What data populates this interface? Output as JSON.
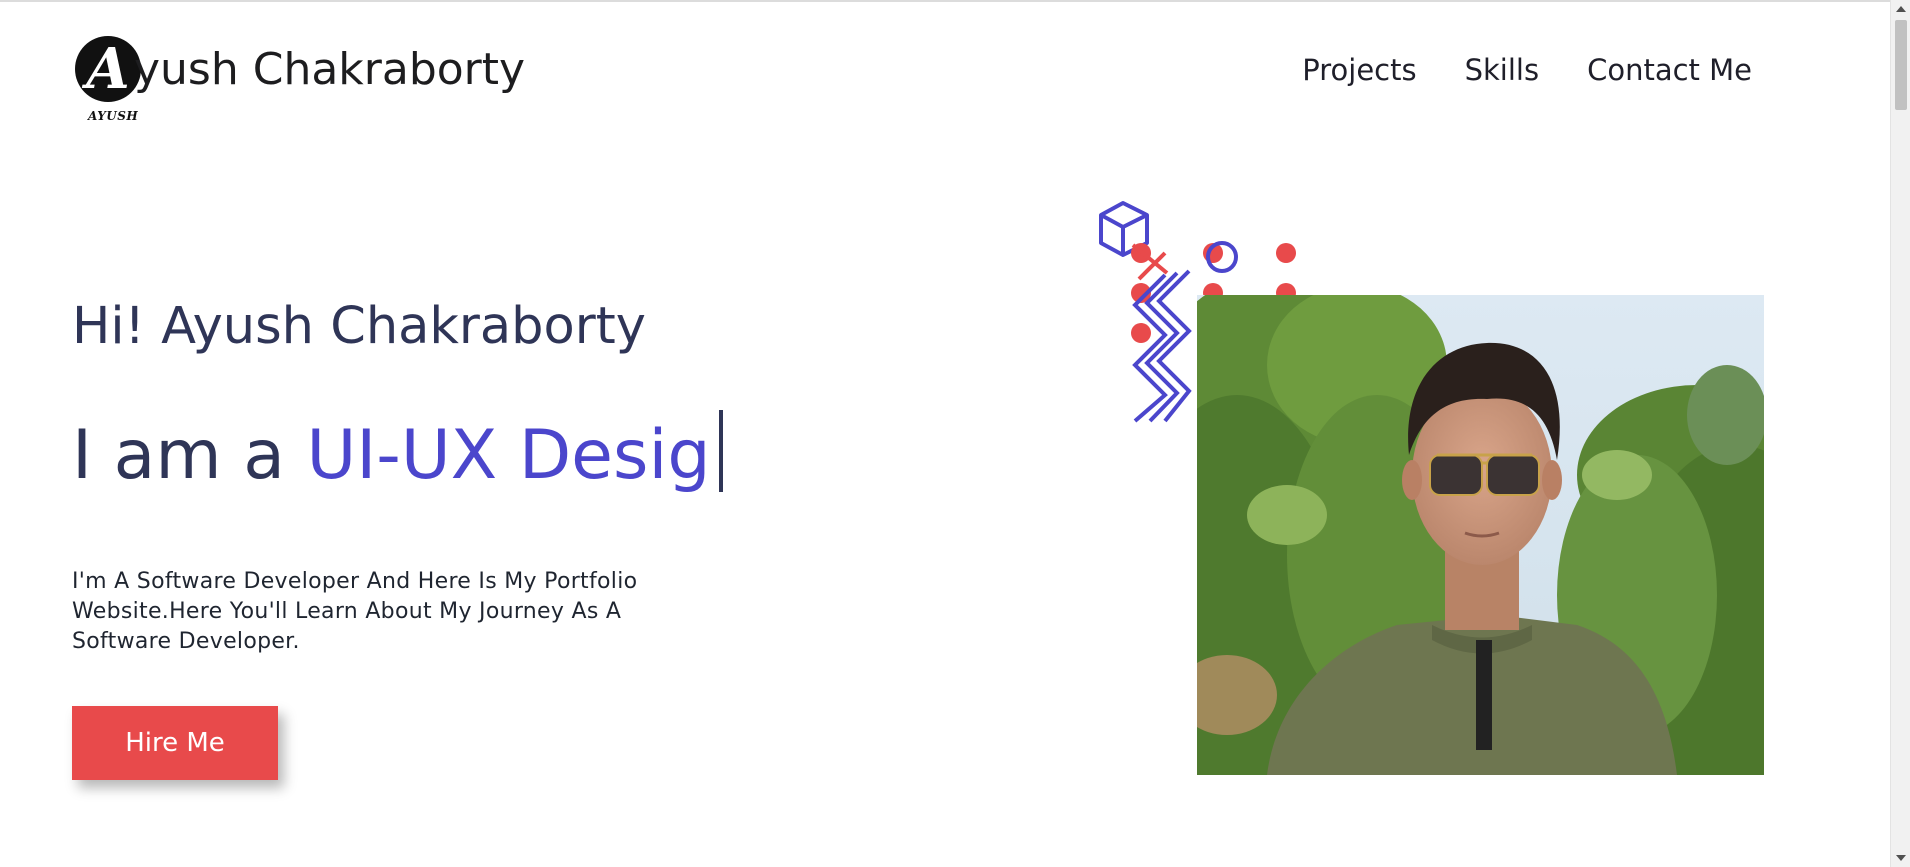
{
  "header": {
    "logo_letter": "A",
    "logo_caption": "AYUSH",
    "brand_name": "yush Chakraborty",
    "nav": [
      {
        "label": "Projects"
      },
      {
        "label": "Skills"
      },
      {
        "label": "Contact Me"
      }
    ]
  },
  "hero": {
    "greeting": "Hi! Ayush Chakraborty",
    "iam_prefix": "I am a ",
    "typed_role": "UI-UX Desig",
    "description": "I'm A Software Developer And Here Is My Portfolio Website.Here You'll Learn About My Journey As A Software Developer.",
    "cta_label": "Hire Me"
  },
  "colors": {
    "accent": "#4b46cc",
    "cta": "#e84a4b",
    "text_dark": "#2f3557",
    "decor_red": "#e84a4b",
    "decor_blue": "#4b46cc"
  },
  "icons": {
    "logo": "logo-icon",
    "cube": "cube-icon",
    "zigzag": "zigzag-icon"
  }
}
